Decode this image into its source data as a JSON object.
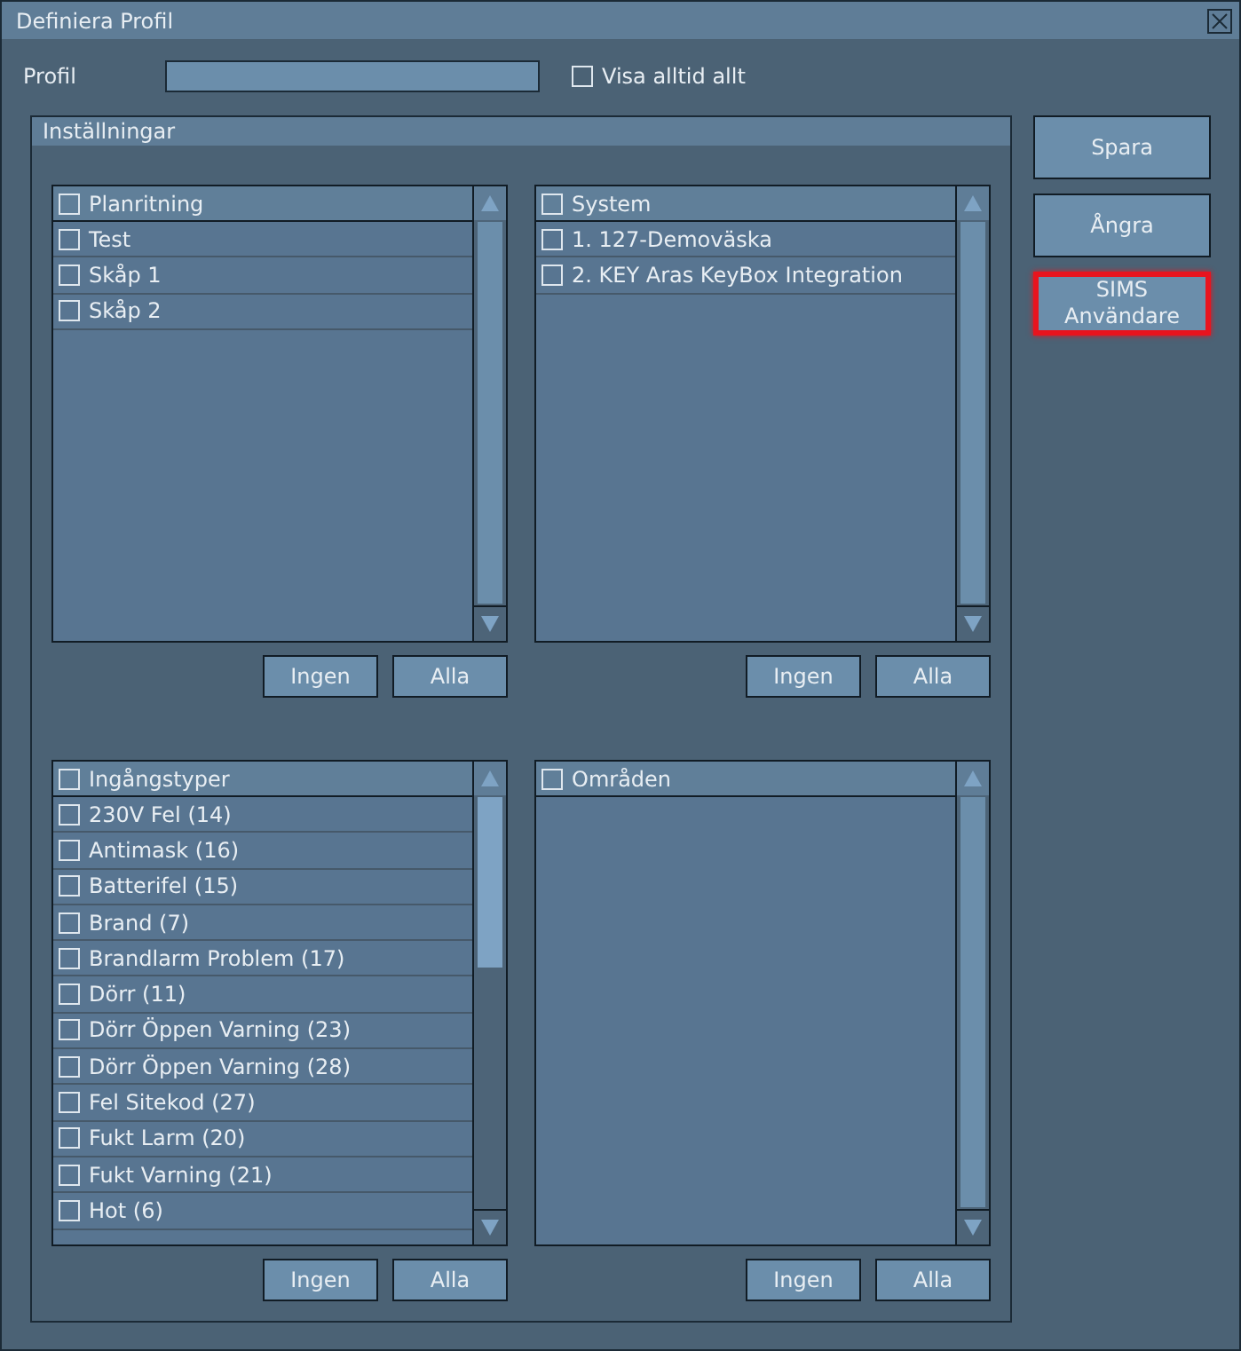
{
  "window": {
    "title": "Definiera Profil"
  },
  "profile": {
    "label": "Profil",
    "show_all": {
      "label": "Visa alltid allt",
      "checked": false
    }
  },
  "settings": {
    "title": "Inställningar",
    "panels": [
      {
        "header": {
          "label": "Planritning",
          "checked": false
        },
        "items": [
          {
            "label": "Test",
            "checked": false
          },
          {
            "label": "Skåp 1",
            "checked": false
          },
          {
            "label": "Skåp 2",
            "checked": false
          }
        ],
        "buttons": [
          "Ingen",
          "Alla"
        ]
      },
      {
        "header": {
          "label": "System",
          "checked": false
        },
        "items": [
          {
            "label": "1. 127-Demoväska",
            "checked": false
          },
          {
            "label": "2. KEY Aras KeyBox Integration",
            "checked": false
          }
        ],
        "buttons": [
          "Ingen",
          "Alla"
        ]
      },
      {
        "header": {
          "label": "Ingångstyper",
          "checked": false
        },
        "items": [
          {
            "label": "230V Fel (14)",
            "checked": false
          },
          {
            "label": "Antimask (16)",
            "checked": false
          },
          {
            "label": "Batterifel (15)",
            "checked": false
          },
          {
            "label": "Brand (7)",
            "checked": false
          },
          {
            "label": "Brandlarm Problem (17)",
            "checked": false
          },
          {
            "label": "Dörr (11)",
            "checked": false
          },
          {
            "label": "Dörr Öppen Varning (23)",
            "checked": false
          },
          {
            "label": "Dörr Öppen Varning (28)",
            "checked": false
          },
          {
            "label": "Fel Sitekod (27)",
            "checked": false
          },
          {
            "label": "Fukt Larm (20)",
            "checked": false
          },
          {
            "label": "Fukt Varning (21)",
            "checked": false
          },
          {
            "label": "Hot (6)",
            "checked": false
          }
        ],
        "buttons": [
          "Ingen",
          "Alla"
        ]
      },
      {
        "header": {
          "label": "Områden",
          "checked": false
        },
        "buttons": [
          "Ingen",
          "Alla"
        ]
      }
    ]
  },
  "actions": [
    {
      "label": "Spara",
      "highlighted": false
    },
    {
      "label": "Ångra",
      "highlighted": false
    },
    {
      "label": "SIMS Användare",
      "highlighted": true
    }
  ]
}
